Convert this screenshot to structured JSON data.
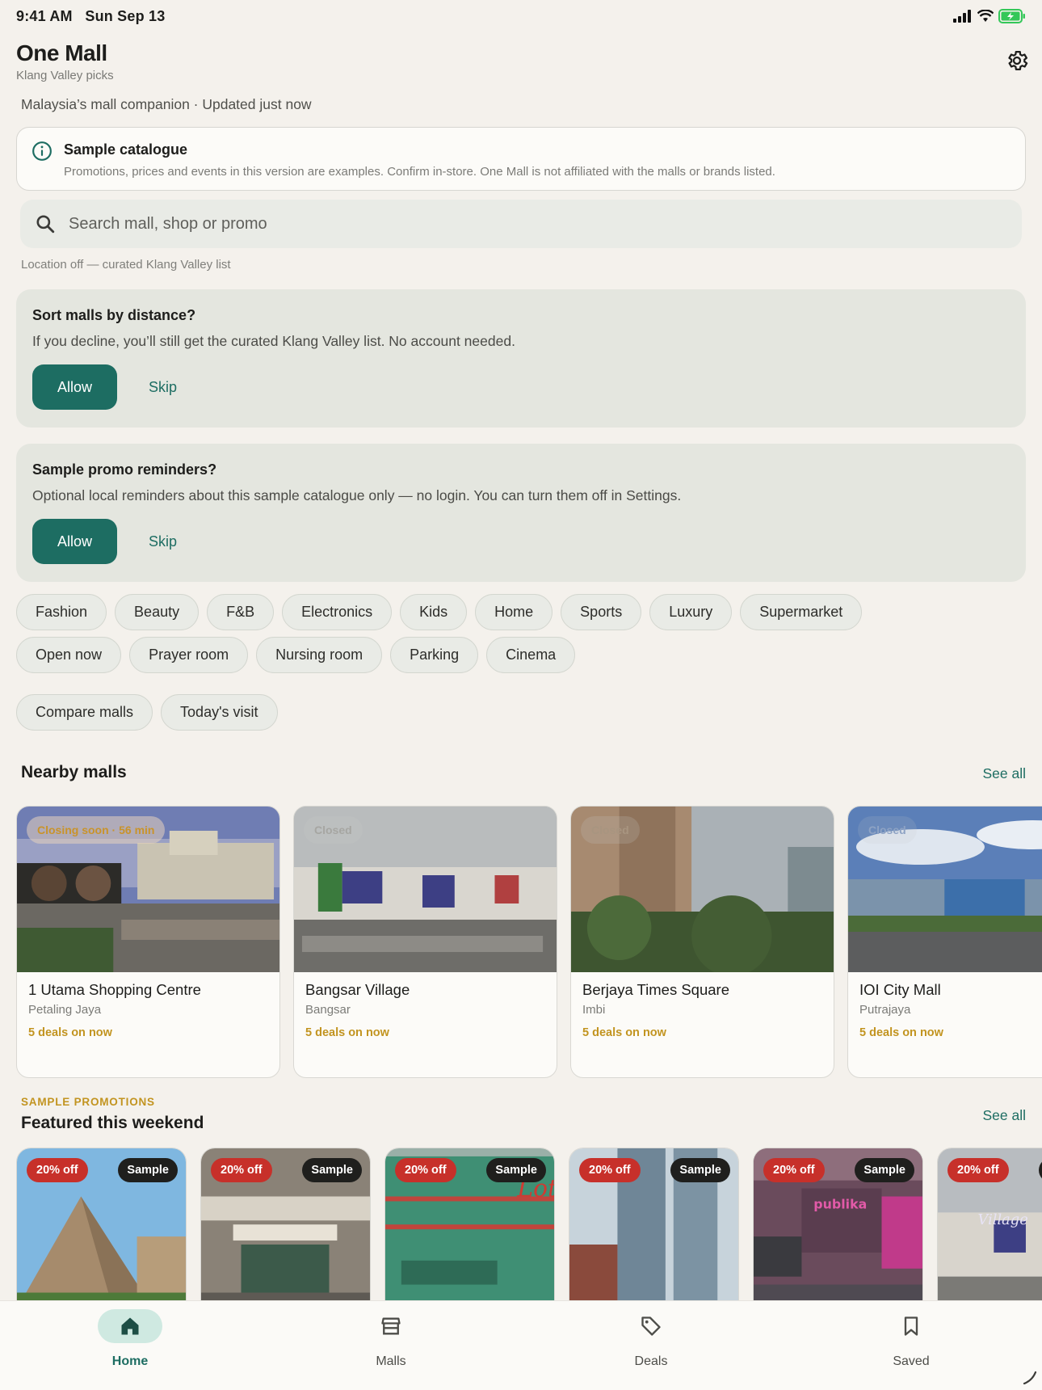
{
  "status_bar": {
    "time": "9:41 AM",
    "date": "Sun Sep 13"
  },
  "header": {
    "title": "One Mall",
    "subtitle": "Klang Valley picks",
    "tagline": "Malaysia’s mall companion · Updated just now"
  },
  "notice": {
    "title": "Sample catalogue",
    "body": "Promotions, prices and events in this version are examples. Confirm in-store. One Mall is not affiliated with the malls or brands listed."
  },
  "search": {
    "placeholder": "Search mall, shop or promo"
  },
  "location_note": "Location off — curated Klang Valley list",
  "location_prompt": {
    "title": "Sort malls by distance?",
    "body": "If you decline, you’ll still get the curated Klang Valley list. No account needed.",
    "allow": "Allow",
    "skip": "Skip"
  },
  "reminder_prompt": {
    "title": "Sample promo reminders?",
    "body": "Optional local reminders about this sample catalogue only — no login. You can turn them off in Settings.",
    "allow": "Allow",
    "skip": "Skip"
  },
  "category_chips": [
    "Fashion",
    "Beauty",
    "F&B",
    "Electronics",
    "Kids",
    "Home",
    "Sports",
    "Luxury",
    "Supermarket"
  ],
  "amenity_chips": [
    "Open now",
    "Prayer room",
    "Nursing room",
    "Parking",
    "Cinema"
  ],
  "tool_chips": [
    "Compare malls",
    "Today's visit"
  ],
  "nearby": {
    "title": "Nearby malls",
    "see_all": "See all",
    "malls": [
      {
        "name": "1 Utama Shopping Centre",
        "area": "Petaling Jaya",
        "deals": "5 deals on now",
        "status": "Closing soon · 56 min"
      },
      {
        "name": "Bangsar Village",
        "area": "Bangsar",
        "deals": "5 deals on now",
        "status": "Closed"
      },
      {
        "name": "Berjaya Times Square",
        "area": "Imbi",
        "deals": "5 deals on now",
        "status": "Closed"
      },
      {
        "name": "IOI City Mall",
        "area": "Putrajaya",
        "deals": "5 deals on now",
        "status": "Closed"
      }
    ]
  },
  "featured": {
    "overline": "SAMPLE PROMOTIONS",
    "title": "Featured this weekend",
    "see_all": "See all",
    "discount": "20% off",
    "sample_tag": "Sample",
    "photo_text": [
      "Lot",
      "publika",
      "Village"
    ]
  },
  "tabs": [
    {
      "label": "Home",
      "icon": "home-icon"
    },
    {
      "label": "Malls",
      "icon": "store-icon"
    },
    {
      "label": "Deals",
      "icon": "tag-icon"
    },
    {
      "label": "Saved",
      "icon": "bookmark-icon"
    }
  ],
  "colors": {
    "accent": "#1d6d62",
    "deal_gold": "#c29420",
    "discount_red": "#c7302a",
    "background": "#f4f1ec"
  }
}
